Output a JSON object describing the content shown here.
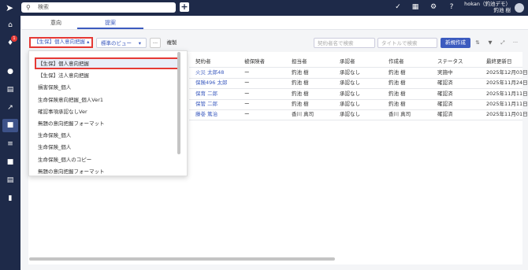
{
  "topbar": {
    "search_placeholder": "検索",
    "user_name": "hokan（釣池デモ）",
    "user_sub": "釣池 樹"
  },
  "icons": {
    "search": "search-icon",
    "plus": "plus-icon",
    "check": "check-circle-icon",
    "calendar": "calendar-icon",
    "settings": "gear-icon",
    "help": "help-icon"
  },
  "sidebar": {
    "notification_count": "1"
  },
  "tabs": [
    "意向",
    "提案"
  ],
  "toolbar": {
    "selected_format": "【生保】個人意向把握",
    "view_select": "標準のビュー",
    "more_label": "···",
    "duplicate": "複製",
    "search_contract_placeholder": "契約者名で検索",
    "search_title_placeholder": "タイトルで検索",
    "new_button": "新規作成"
  },
  "table": {
    "headers": [
      "契約者",
      "被保険者",
      "担当者",
      "承認者",
      "作成者",
      "ステータス",
      "最終更新日"
    ],
    "rows": [
      [
        "火災 太郎48",
        "ー",
        "釣池 樹",
        "承認なし",
        "釣池 樹",
        "実施中",
        "2025年12月03日"
      ],
      [
        "保険496 太郎",
        "ー",
        "釣池 樹",
        "承認なし",
        "釣池 樹",
        "確認済",
        "2025年11月24日"
      ],
      [
        "保育 二郎",
        "ー",
        "釣池 樹",
        "承認なし",
        "釣池 樹",
        "確認済",
        "2025年11月11日"
      ],
      [
        "保管 二郎",
        "ー",
        "釣池 樹",
        "承認なし",
        "釣池 樹",
        "確認済",
        "2025年11月11日"
      ],
      [
        "藤巻 篤治",
        "ー",
        "香川 真司",
        "承認なし",
        "香川 真司",
        "確認済",
        "2025年11月01日"
      ]
    ]
  },
  "dropdown": {
    "items": [
      "【生保】個人意向把握",
      "【生保】法人意向把握",
      "損害保険_個人",
      "生命保険意向把握_個人Ver1",
      "確認事項承認なしVer",
      "無題の意向把握フォーマット",
      "生命保険_個人",
      "生命保険_個人",
      "生命保険_個人のコピー",
      "無題の意向把握フォーマット"
    ]
  },
  "colors": {
    "nav": "#1e2a49",
    "accent": "#3c5bbf",
    "highlight": "#e53935"
  }
}
